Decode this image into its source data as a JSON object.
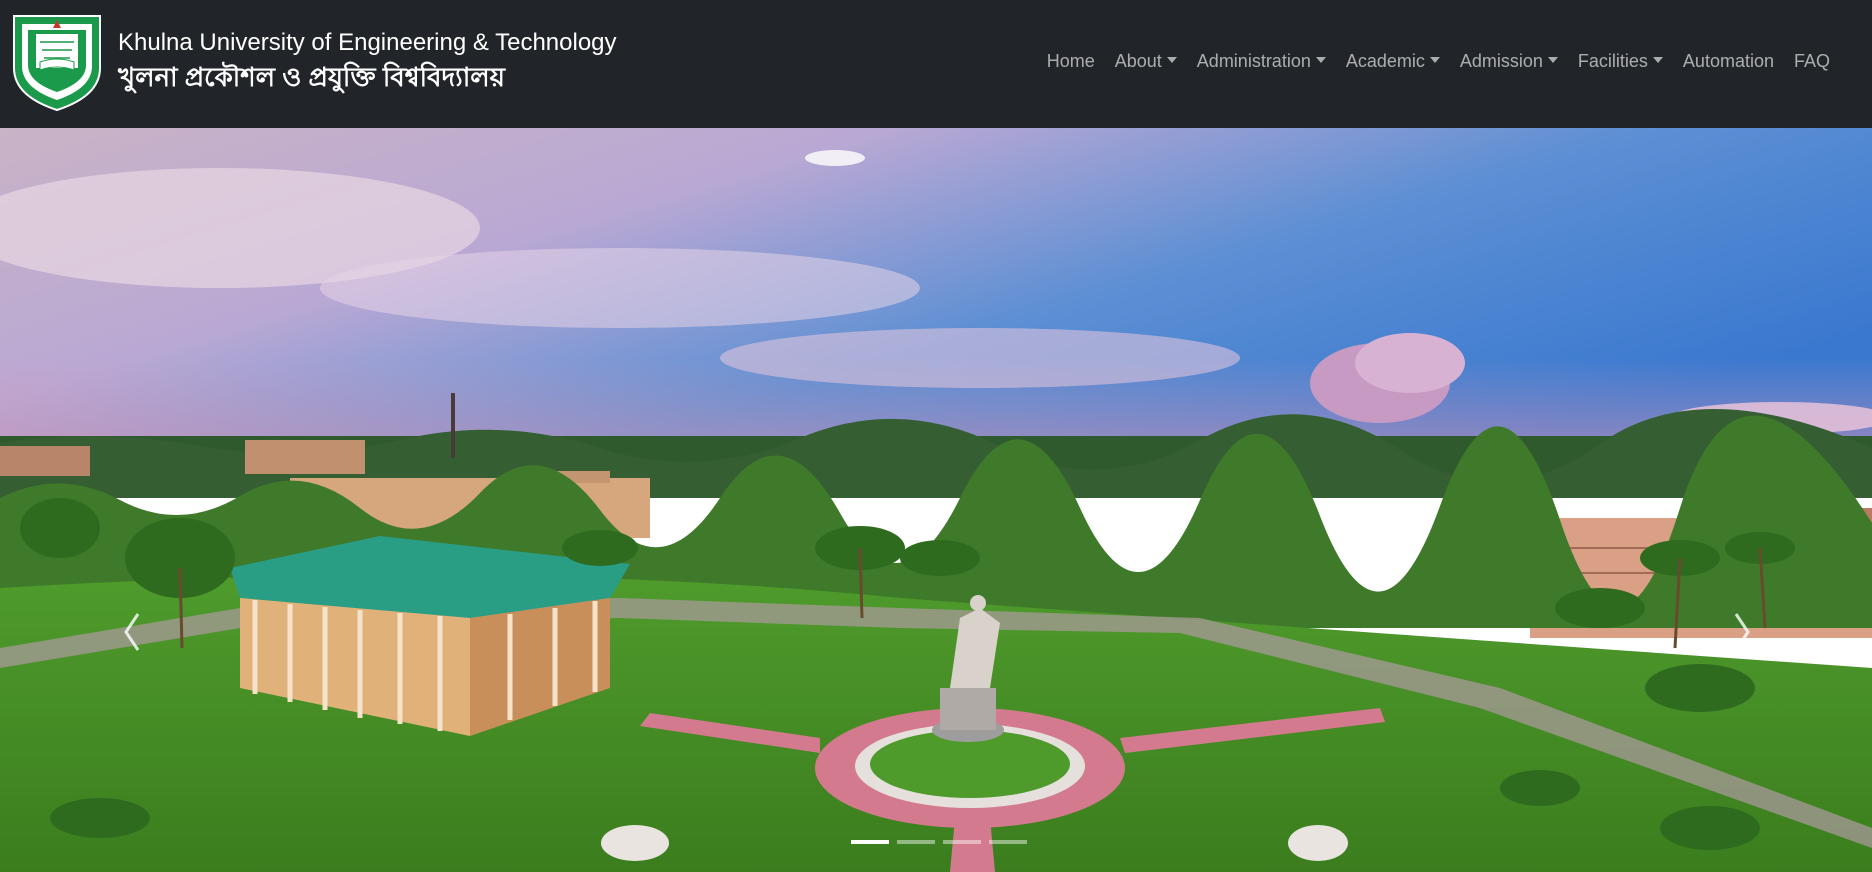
{
  "brand": {
    "name_en": "Khulna University of Engineering & Technology",
    "name_bn": "খুলনা প্রকৌশল ও প্রযুক্তি বিশ্ববিদ্যালয়",
    "logo_text": "প্রজ্ঞা আমার জ্ঞান দাও",
    "logo_ring_text": "খুলনা প্রকৌশল ও প্রযুক্তি বিশ্ববিদ্যালয়"
  },
  "nav": {
    "items": [
      {
        "label": "Home",
        "dropdown": false
      },
      {
        "label": "About",
        "dropdown": true
      },
      {
        "label": "Administration",
        "dropdown": true
      },
      {
        "label": "Academic",
        "dropdown": true
      },
      {
        "label": "Admission",
        "dropdown": true
      },
      {
        "label": "Facilities",
        "dropdown": true
      },
      {
        "label": "Automation",
        "dropdown": false
      },
      {
        "label": "FAQ",
        "dropdown": false
      }
    ]
  },
  "carousel": {
    "slide_count": 4,
    "active_index": 0,
    "prev_icon": "chevron-left-icon",
    "next_icon": "chevron-right-icon"
  },
  "colors": {
    "navbar_bg": "#212529",
    "nav_link": "rgba(255,255,255,0.62)",
    "logo_green": "#1a9a4a"
  }
}
